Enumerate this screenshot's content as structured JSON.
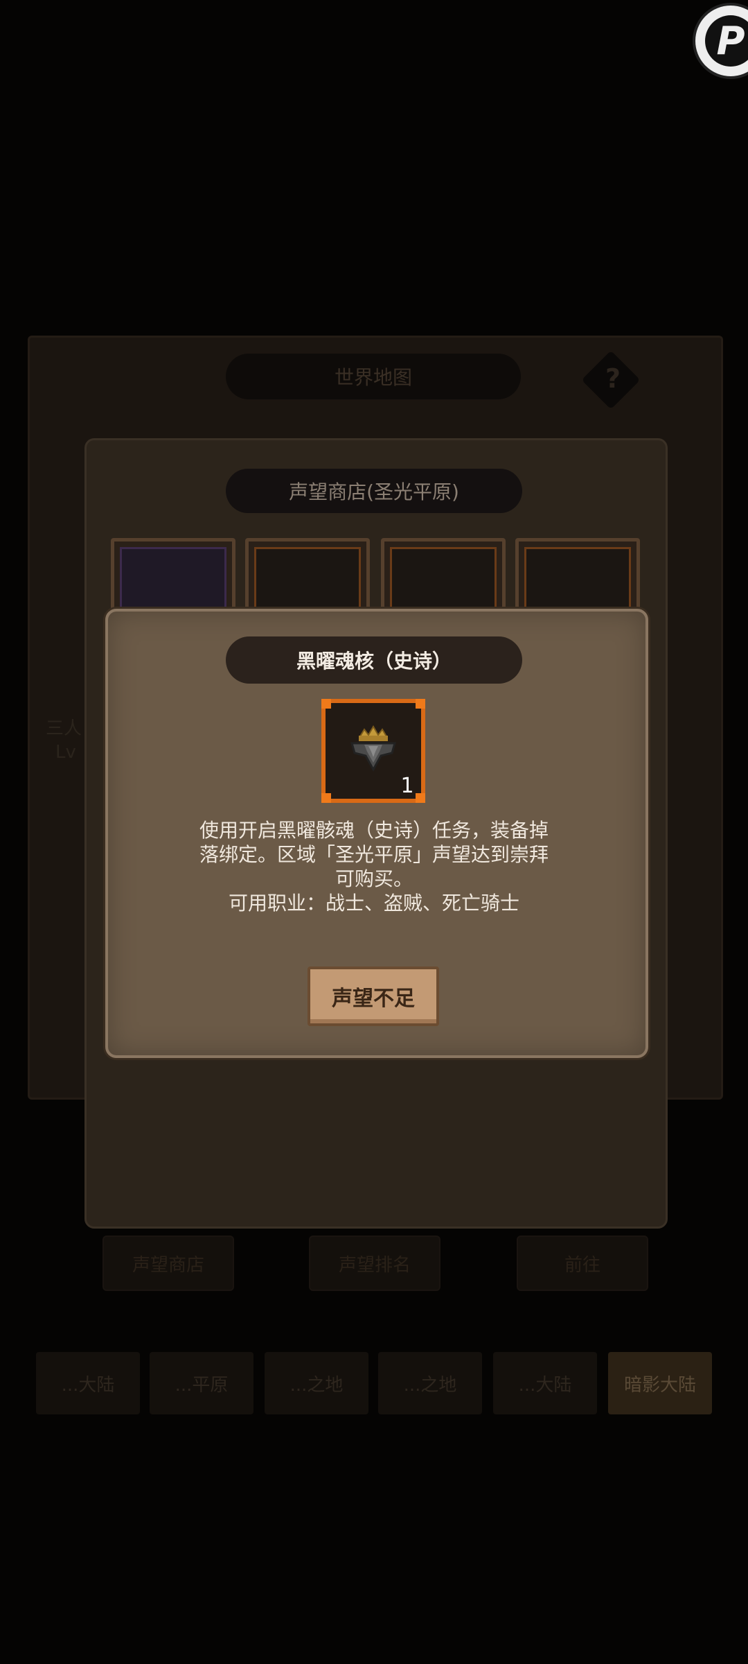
{
  "background": {
    "world_map_title": "世界地图",
    "help_symbol": "?",
    "shop_title": "声望商店(圣光平原)",
    "row_buttons": [
      "声望商店",
      "声望排名",
      "前往"
    ],
    "tabs": [
      "...大陆",
      "...平原",
      "...之地",
      "...之地",
      "...大陆",
      "暗影大陆"
    ],
    "side_texts": [
      "三人",
      "Lv"
    ]
  },
  "badge": {
    "letter": "P"
  },
  "dialog": {
    "title": "黑曜魂核（史诗）",
    "item_icon": "obsidian-core-icon",
    "item_count": "1",
    "description_lines": [
      "使用开启黑曜骸魂（史诗）任务，装备掉",
      "落绑定。区域「圣光平原」声望达到崇拜",
      "可购买。",
      "可用职业：战士、盗贼、死亡骑士"
    ],
    "button_label": "声望不足"
  },
  "colors": {
    "dialog_bg": "#6b5a47",
    "item_border": "#d96a16",
    "button_bg": "#c39a74"
  }
}
